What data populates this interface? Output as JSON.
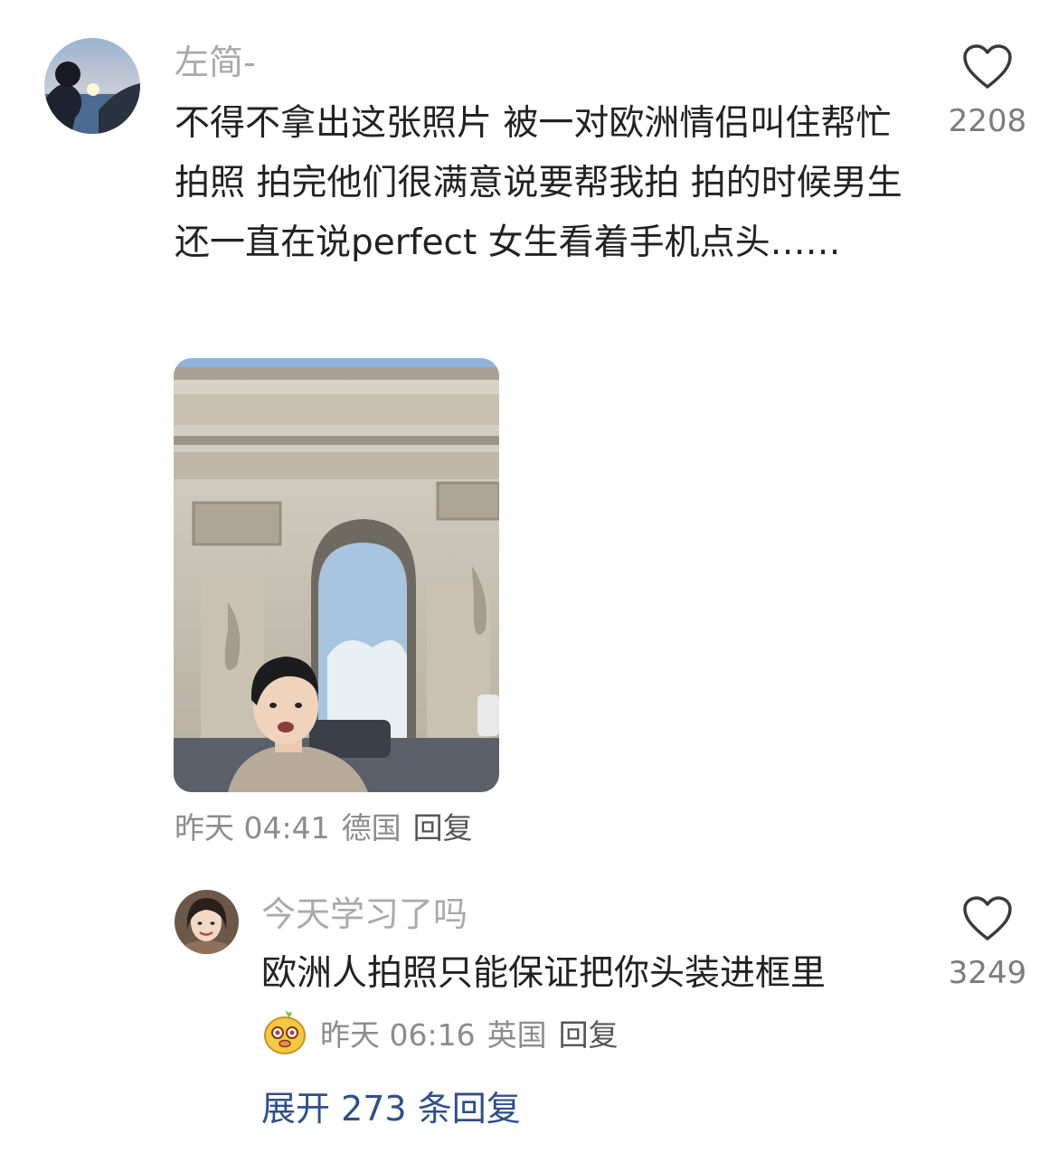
{
  "comment": {
    "username": "左简-",
    "text": "不得不拿出这张照片 被一对欧洲情侣叫住帮忙拍照 拍完他们很满意说要帮我拍 拍的时候男生还一直在说perfect 女生看着手机点头……",
    "time": "昨天 04:41",
    "location": "德国",
    "reply_label": "回复",
    "likes": "2208"
  },
  "reply": {
    "username": "今天学习了吗",
    "text": "欧洲人拍照只能保证把你头装进框里",
    "time": "昨天 06:16",
    "location": "英国",
    "reply_label": "回复",
    "likes": "3249"
  },
  "expand_label": "展开 273 条回复",
  "icons": {
    "like": "heart-outline-icon",
    "reply_badge": "mascot-sticker-icon"
  },
  "colors": {
    "username": "#a9a9a9",
    "meta": "#8c8c8c",
    "link": "#2f4f86",
    "text": "#222222"
  }
}
